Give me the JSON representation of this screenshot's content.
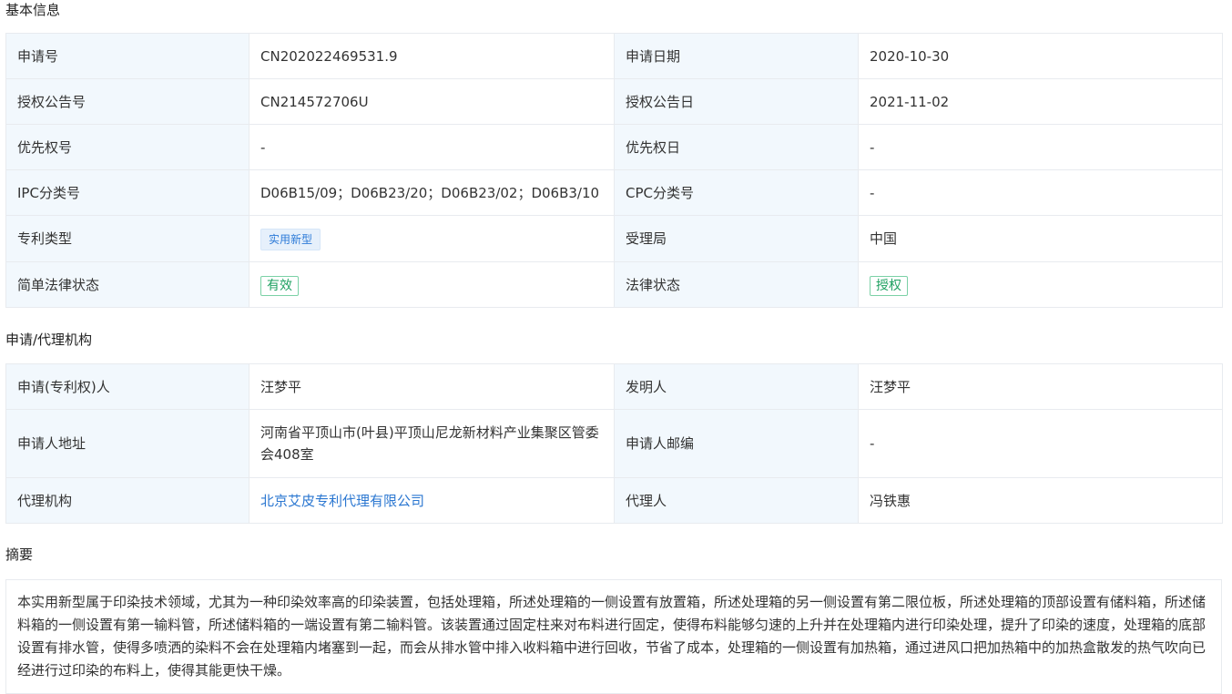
{
  "basic": {
    "title": "基本信息",
    "app_no_label": "申请号",
    "app_no": "CN202022469531.9",
    "app_date_label": "申请日期",
    "app_date": "2020-10-30",
    "grant_no_label": "授权公告号",
    "grant_no": "CN214572706U",
    "grant_date_label": "授权公告日",
    "grant_date": "2021-11-02",
    "priority_no_label": "优先权号",
    "priority_no": "-",
    "priority_date_label": "优先权日",
    "priority_date": "-",
    "ipc_label": "IPC分类号",
    "ipc": "D06B15/09；D06B23/20；D06B23/02；D06B3/10",
    "cpc_label": "CPC分类号",
    "cpc": "-",
    "patent_type_label": "专利类型",
    "patent_type": "实用新型",
    "office_label": "受理局",
    "office": "中国",
    "simple_status_label": "简单法律状态",
    "simple_status": "有效",
    "legal_status_label": "法律状态",
    "legal_status": "授权"
  },
  "agency": {
    "title": "申请/代理机构",
    "applicant_label": "申请(专利权)人",
    "applicant": "汪梦平",
    "inventor_label": "发明人",
    "inventor": "汪梦平",
    "address_label": "申请人地址",
    "address": "河南省平顶山市(叶县)平顶山尼龙新材料产业集聚区管委会408室",
    "postcode_label": "申请人邮编",
    "postcode": "-",
    "agency_label": "代理机构",
    "agency_name": "北京艾皮专利代理有限公司",
    "agent_label": "代理人",
    "agent": "冯铁惠"
  },
  "abstract": {
    "title": "摘要",
    "text": "本实用新型属于印染技术领域，尤其为一种印染效率高的印染装置，包括处理箱，所述处理箱的一侧设置有放置箱，所述处理箱的另一侧设置有第二限位板，所述处理箱的顶部设置有储料箱，所述储料箱的一侧设置有第一输料管，所述储料箱的一端设置有第二输料管。该装置通过固定柱来对布料进行固定，使得布料能够匀速的上升并在处理箱内进行印染处理，提升了印染的速度，处理箱的底部设置有排水管，使得多喷洒的染料不会在处理箱内堵塞到一起，而会从排水管中排入收料箱中进行回收，节省了成本，处理箱的一侧设置有加热箱，通过进风口把加热箱中的加热盒散发的热气吹向已经进行过印染的布料上，使得其能更快干燥。"
  }
}
